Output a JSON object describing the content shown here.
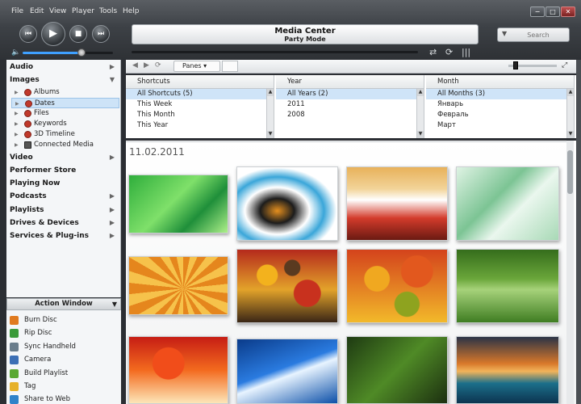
{
  "menu": [
    "File",
    "Edit",
    "View",
    "Player",
    "Tools",
    "Help"
  ],
  "window_controls": {
    "minimize": "−",
    "maximize": "□",
    "close": "✕"
  },
  "transport": {
    "prev": "⏮",
    "play": "▶",
    "stop": "■",
    "next": "⏭"
  },
  "now_playing": {
    "title": "Media Center",
    "subtitle": "Party Mode"
  },
  "search": {
    "placeholder": "Search"
  },
  "volume": {
    "level": 0.65
  },
  "sidebar": {
    "sections": [
      {
        "label": "Audio"
      },
      {
        "label": "Images"
      },
      {
        "label": "Video"
      },
      {
        "label": "Performer Store"
      },
      {
        "label": "Playing Now"
      },
      {
        "label": "Podcasts"
      },
      {
        "label": "Playlists"
      },
      {
        "label": "Drives & Devices"
      },
      {
        "label": "Services & Plug-ins"
      }
    ],
    "image_items": [
      {
        "label": "Albums"
      },
      {
        "label": "Dates"
      },
      {
        "label": "Files"
      },
      {
        "label": "Keywords"
      },
      {
        "label": "3D Timeline"
      },
      {
        "label": "Connected Media"
      }
    ]
  },
  "action_window": {
    "title": "Action Window",
    "items": [
      {
        "label": "Burn Disc",
        "color": "#e07a1f"
      },
      {
        "label": "Rip Disc",
        "color": "#3a9a3a"
      },
      {
        "label": "Sync Handheld",
        "color": "#6a7d8c"
      },
      {
        "label": "Camera",
        "color": "#3c6fb5"
      },
      {
        "label": "Build Playlist",
        "color": "#59a832"
      },
      {
        "label": "Tag",
        "color": "#e6b12a"
      },
      {
        "label": "Share to Web",
        "color": "#2f82c9"
      }
    ]
  },
  "panebar": {
    "panes_label": "Panes ▾"
  },
  "panes": [
    {
      "header": "Shortcuts",
      "rows": [
        "All Shortcuts (5)",
        "This Week",
        "This Month",
        "This Year"
      ]
    },
    {
      "header": "Year",
      "rows": [
        "All Years (2)",
        "2011",
        "2008"
      ]
    },
    {
      "header": "Month",
      "rows": [
        "All Months (3)",
        "Январь",
        "Февраль",
        "Март"
      ]
    }
  ],
  "gallery": {
    "date_heading": "11.02.2011"
  }
}
